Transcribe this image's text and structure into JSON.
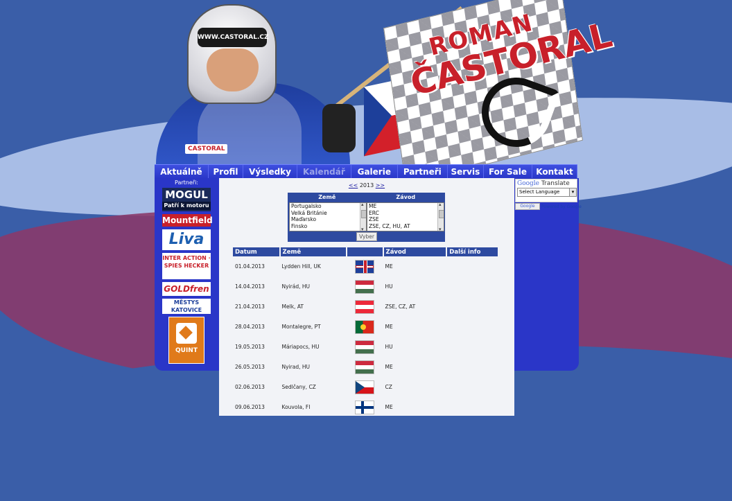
{
  "header": {
    "helmet_text": "WWW.CASTORAL.CZ",
    "suit_logo": "CASTORAL",
    "flag_line1": "ROMAN",
    "flag_line2": "ČASTORAL"
  },
  "nav": {
    "items": [
      {
        "label": "Aktuálně",
        "width": 78
      },
      {
        "label": "Profil",
        "width": 50
      },
      {
        "label": "Výsledky",
        "width": 78
      },
      {
        "label": "Kalendář",
        "width": 78
      },
      {
        "label": "Galerie",
        "width": 67
      },
      {
        "label": "Partneři",
        "width": 72
      },
      {
        "label": "Servis",
        "width": 52
      },
      {
        "label": "For Sale",
        "width": 70
      },
      {
        "label": "Kontakt",
        "width": 65
      }
    ],
    "active": "Kalendář"
  },
  "sidebar": {
    "title": "Partneři:",
    "logos": {
      "mogul": "MOGUL",
      "mogul_tag": "Patří k motoru",
      "mountfield": "Mountfield",
      "liva": "Liva",
      "inter": "INTER ACTION · SPIES HECKER",
      "gold": "GOLDfren",
      "katovice": "MĚSTYS KATOVICE",
      "quint": "QUINT"
    }
  },
  "calendar": {
    "prev": "<<",
    "year": "2013",
    "next": ">>",
    "filter": {
      "col1": "Země",
      "col2": "Závod",
      "countries": [
        "Portugalsko",
        "Velká Británie",
        "Maďarsko",
        "Finsko"
      ],
      "races": [
        "ME",
        "ERC",
        "ZSE",
        "ZSE, CZ, HU, AT"
      ],
      "button": "Vyber"
    },
    "columns": [
      "Datum",
      "Země",
      "",
      "Závod",
      "Další info"
    ],
    "rows": [
      {
        "date": "01.04.2013",
        "place": "Lydden Hill, UK",
        "flag": "uk",
        "race": "ME"
      },
      {
        "date": "14.04.2013",
        "place": "Nyirád, HU",
        "flag": "hu",
        "race": "HU"
      },
      {
        "date": "21.04.2013",
        "place": "Melk, AT",
        "flag": "at",
        "race": "ZSE, CZ, AT"
      },
      {
        "date": "28.04.2013",
        "place": "Montalegre, PT",
        "flag": "pt",
        "race": "ME"
      },
      {
        "date": "19.05.2013",
        "place": "Máriapocs, HU",
        "flag": "hu",
        "race": "HU"
      },
      {
        "date": "26.05.2013",
        "place": "Nyirad, HU",
        "flag": "hu",
        "race": "ME"
      },
      {
        "date": "02.06.2013",
        "place": "Sedlčany, CZ",
        "flag": "cz",
        "race": "CZ"
      },
      {
        "date": "09.06.2013",
        "place": "Kouvola, FI",
        "flag": "fi",
        "race": "ME"
      }
    ]
  },
  "translate": {
    "brand": "Google",
    "title": "Translate",
    "select": "Select Language",
    "powered": "Powered by Google"
  }
}
